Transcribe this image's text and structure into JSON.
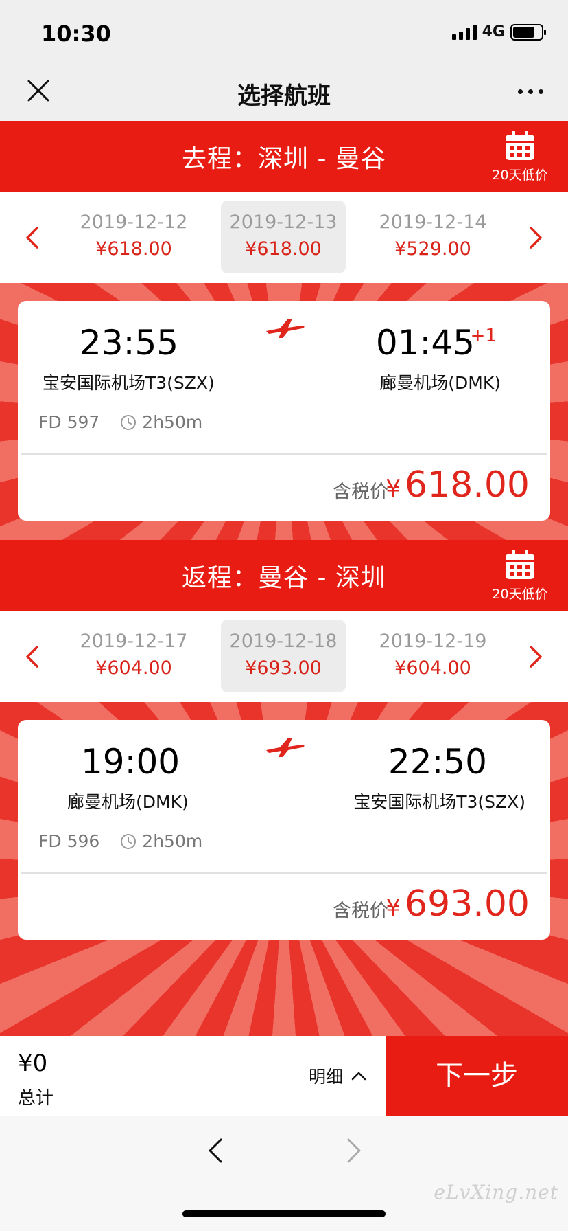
{
  "status_bar": {
    "time": "10:30",
    "network": "4G"
  },
  "nav": {
    "title": "选择航班"
  },
  "outbound": {
    "header": "去程：深圳 - 曼谷",
    "low_price_label": "20天低价",
    "dates": [
      {
        "date": "2019-12-12",
        "price": "¥618.00"
      },
      {
        "date": "2019-12-13",
        "price": "¥618.00"
      },
      {
        "date": "2019-12-14",
        "price": "¥529.00"
      }
    ],
    "flight": {
      "dep_time": "23:55",
      "arr_time": "01:45",
      "arr_day_offset": "+1",
      "dep_airport": "宝安国际机场T3(SZX)",
      "arr_airport": "廊曼机场(DMK)",
      "flight_no": "FD 597",
      "duration": "2h50m",
      "tax_label": "含税价",
      "currency": "¥",
      "fare": "618.00"
    }
  },
  "return": {
    "header": "返程：曼谷 - 深圳",
    "low_price_label": "20天低价",
    "dates": [
      {
        "date": "2019-12-17",
        "price": "¥604.00"
      },
      {
        "date": "2019-12-18",
        "price": "¥693.00"
      },
      {
        "date": "2019-12-19",
        "price": "¥604.00"
      }
    ],
    "flight": {
      "dep_time": "19:00",
      "arr_time": "22:50",
      "dep_airport": "廊曼机场(DMK)",
      "arr_airport": "宝安国际机场T3(SZX)",
      "flight_no": "FD 596",
      "duration": "2h50m",
      "tax_label": "含税价",
      "currency": "¥",
      "fare": "693.00"
    }
  },
  "bottom_bar": {
    "total_amount": "¥0",
    "total_label": "总计",
    "detail_label": "明细",
    "next_label": "下一步"
  },
  "watermark": "eLvXing.net",
  "colors": {
    "brand_red": "#e81c12",
    "price_red": "#d92318"
  }
}
